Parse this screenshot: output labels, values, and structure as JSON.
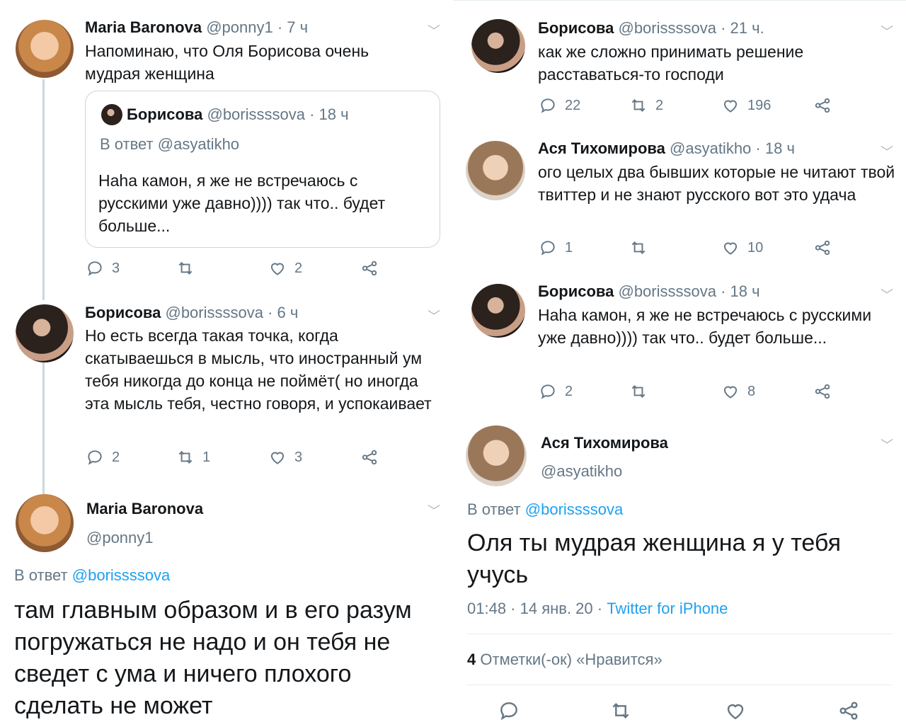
{
  "left": {
    "tweet1": {
      "name": "Maria Baronova",
      "handle": "@ponny1",
      "time": "· 7 ч",
      "text": "Напоминаю, что Оля Борисова очень мудрая женщина",
      "quote": {
        "name": "Борисова",
        "handle": "@borissssova",
        "time": "· 18 ч",
        "reply_prefix": "В ответ",
        "reply_handle": "@asyatikho",
        "text": "Haha камон, я же не встречаюсь с русскими уже давно)))) так что.. будет больше..."
      },
      "replies": "3",
      "retweets": "",
      "likes": "2"
    },
    "tweet2": {
      "name": "Борисова",
      "handle": "@borissssova",
      "time": "· 6 ч",
      "text": "Но есть всегда такая точка, когда скатываешься в мысль, что иностранный ум тебя никогда до конца не поймёт( но иногда эта мысль тебя, честно говоря, и успокаивает",
      "replies": "2",
      "retweets": "1",
      "likes": "3"
    },
    "main": {
      "name": "Maria Baronova",
      "handle": "@ponny1",
      "reply_prefix": "В ответ",
      "reply_handle": "@borissssova",
      "text": "там главным образом и в его разум погружаться не надо и он тебя не сведет с ума и ничего плохого сделать не может"
    }
  },
  "right": {
    "tweet1": {
      "name": "Борисова",
      "handle": "@borissssova",
      "time": "· 21 ч.",
      "text": "как же сложно принимать решение расставаться-то господи",
      "replies": "22",
      "retweets": "2",
      "likes": "196"
    },
    "tweet2": {
      "name": "Ася Тихомирова",
      "handle": "@asyatikho",
      "time": "· 18 ч",
      "text": "ого целых два бывших которые не читают твой твиттер и не знают русского вот это удача",
      "replies": "1",
      "retweets": "",
      "likes": "10"
    },
    "tweet3": {
      "name": "Борисова",
      "handle": "@borissssova",
      "time": "· 18 ч",
      "text": "Haha камон, я же не встречаюсь с русскими уже давно)))) так что.. будет больше...",
      "replies": "2",
      "retweets": "",
      "likes": "8"
    },
    "main": {
      "name": "Ася Тихомирова",
      "handle": "@asyatikho",
      "reply_prefix": "В ответ",
      "reply_handle": "@borissssova",
      "text": "Оля ты мудрая женщина я у тебя учусь",
      "timestamp": "01:48 · 14 янв. 20 ·",
      "source": "Twitter for iPhone",
      "likes_count": "4",
      "likes_label": "Отметки(-ок) «Нравится»"
    }
  },
  "icons": {
    "reply": "reply-icon",
    "retweet": "retweet-icon",
    "like": "heart-icon",
    "share": "share-icon",
    "chevron": "chevron-down-icon"
  },
  "colors": {
    "link": "#1da1f2",
    "secondary": "#657786",
    "thread_line": "#ccd6dd"
  }
}
